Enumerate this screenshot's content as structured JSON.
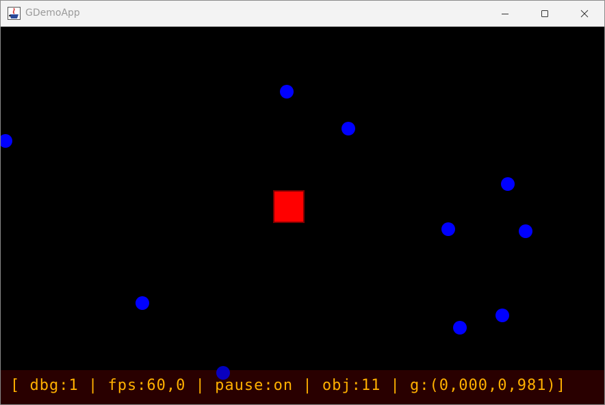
{
  "window": {
    "title": "GDemoApp",
    "icon": "java-app-icon",
    "controls": {
      "minimize_icon": "minimize-icon",
      "maximize_icon": "maximize-icon",
      "close_icon": "close-icon"
    }
  },
  "scene": {
    "background_color": "#000000",
    "ball_color": "#0000ff",
    "player_color": "#ff0000",
    "ball_count": 11
  },
  "debug": {
    "text": "[ dbg:1 | fps:60,0 | pause:on | obj:11 | g:(0,000,0,981)]",
    "text_color": "#ffb000"
  }
}
